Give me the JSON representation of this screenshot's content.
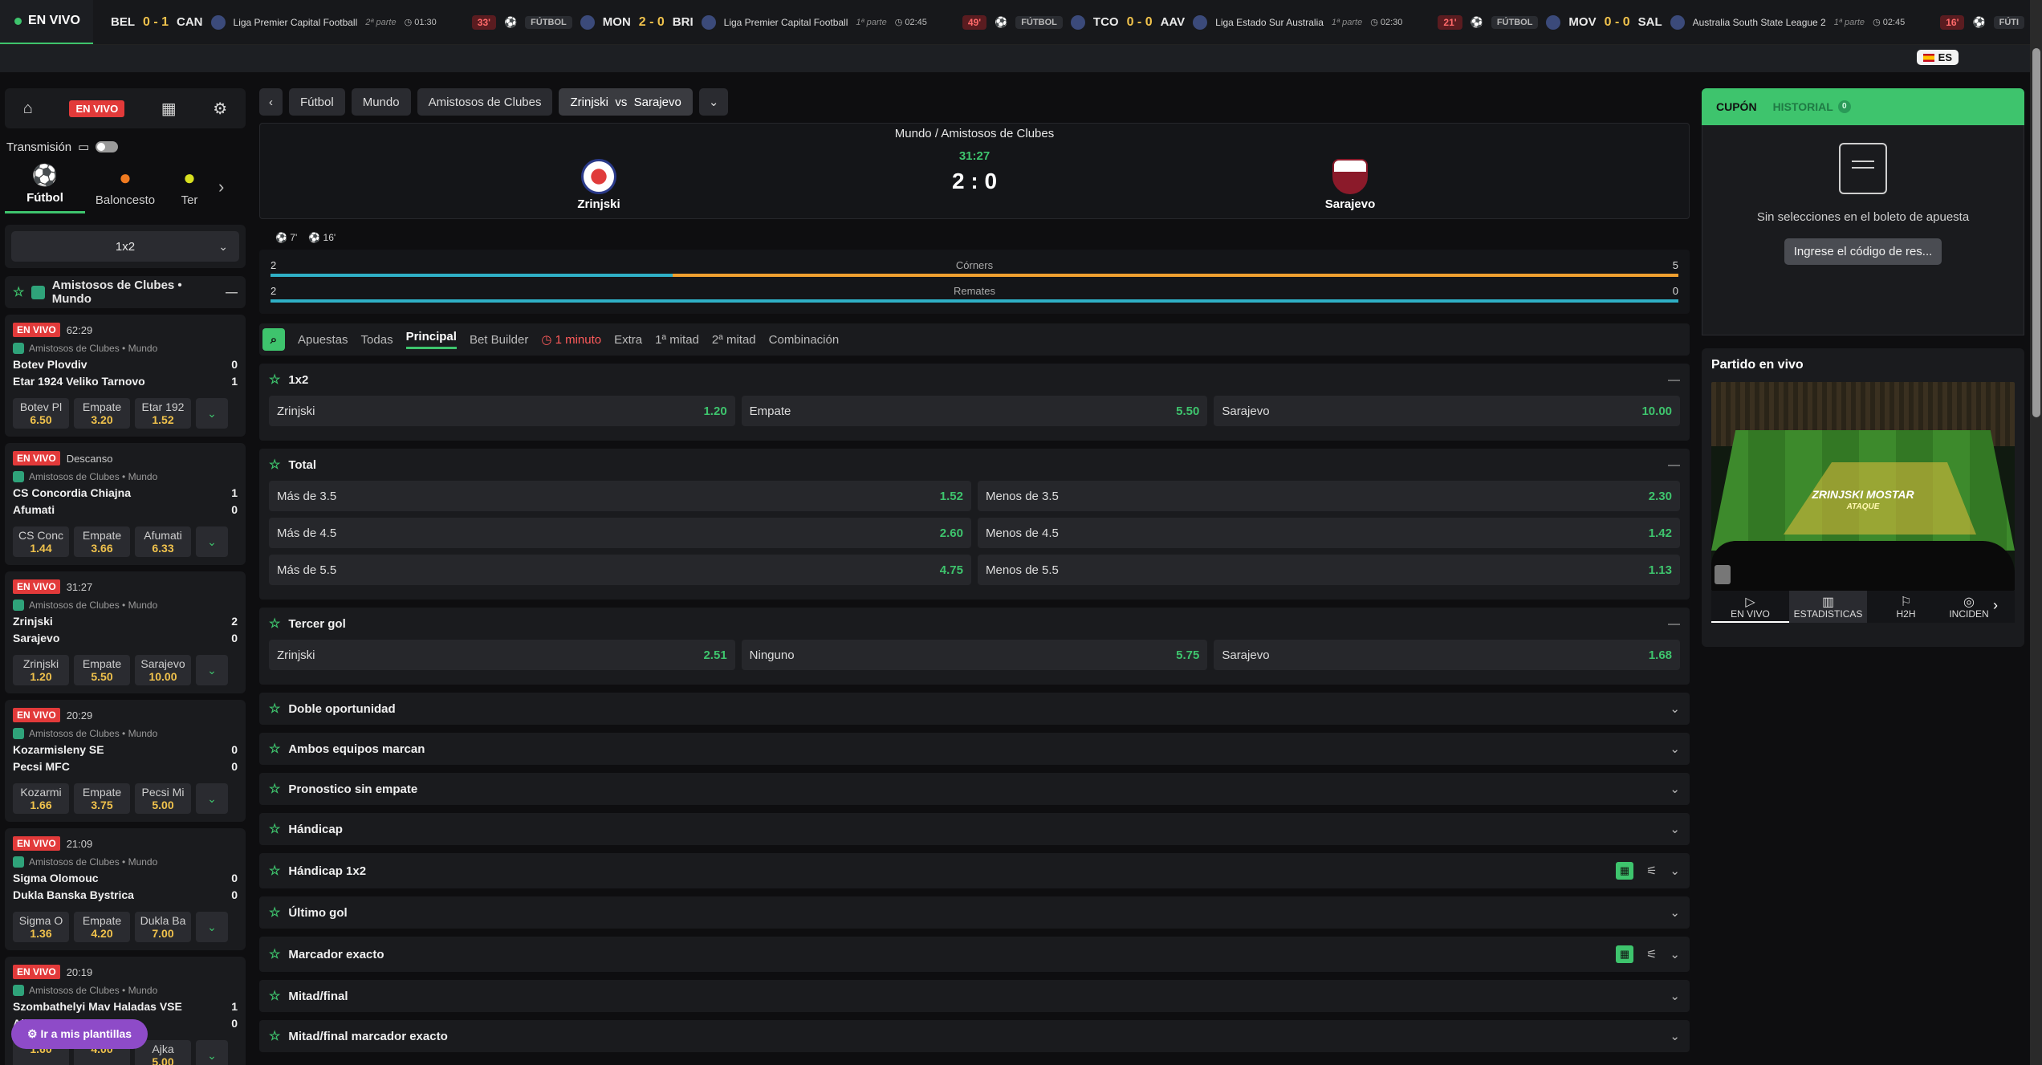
{
  "ticker": {
    "live_label": "EN VIVO",
    "items": [
      {
        "home": "BEL",
        "score": "0 - 1",
        "away": "CAN",
        "league": "Liga Premier Capital Football",
        "half": "2ª parte",
        "clock": "01:30"
      },
      {
        "minute": "33'",
        "sport": "FÚTBOL",
        "home": "MON",
        "score": "2 - 0",
        "away": "BRI",
        "league": "Liga Premier Capital Football",
        "half": "1ª parte",
        "clock": "02:45"
      },
      {
        "minute": "49'",
        "sport": "FÚTBOL",
        "home": "TCO",
        "score": "0 - 0",
        "away": "AAV",
        "league": "Liga Estado Sur Australia",
        "half": "1ª parte",
        "clock": "02:30"
      },
      {
        "minute": "21'",
        "sport": "FÚTBOL",
        "home": "MOV",
        "score": "0 - 0",
        "away": "SAL",
        "league": "Australia South State League 2",
        "half": "1ª parte",
        "clock": "02:45"
      },
      {
        "minute": "16'",
        "sport": "FÚTI"
      }
    ]
  },
  "lang": "ES",
  "sidebar": {
    "live_label": "EN VIVO",
    "transmission_label": "Transmisión",
    "sports": [
      {
        "label": "Fútbol",
        "icon": "soccer-ball-icon"
      },
      {
        "label": "Baloncesto",
        "icon": "basketball-icon"
      },
      {
        "label": "Ter",
        "icon": "tennis-ball-icon"
      }
    ],
    "market_select": "1x2",
    "league_header": "Amistosos de Clubes • Mundo",
    "league_tag": "Amistosos de Clubes • Mundo",
    "cards": [
      {
        "live": "EN VIVO",
        "time": "62:29",
        "home": "Botev Plovdiv",
        "away": "Etar 1924 Veliko Tarnovo",
        "hs": "0",
        "as": "1",
        "odds": [
          {
            "n": "Botev Pl",
            "v": "6.50"
          },
          {
            "n": "Empate",
            "v": "3.20"
          },
          {
            "n": "Etar 192",
            "v": "1.52"
          }
        ]
      },
      {
        "live": "EN VIVO",
        "time": "Descanso",
        "home": "CS Concordia Chiajna",
        "away": "Afumati",
        "hs": "1",
        "as": "0",
        "odds": [
          {
            "n": "CS Conc",
            "v": "1.44"
          },
          {
            "n": "Empate",
            "v": "3.66"
          },
          {
            "n": "Afumati",
            "v": "6.33"
          }
        ]
      },
      {
        "live": "EN VIVO",
        "time": "31:27",
        "home": "Zrinjski",
        "away": "Sarajevo",
        "hs": "2",
        "as": "0",
        "odds": [
          {
            "n": "Zrinjski",
            "v": "1.20"
          },
          {
            "n": "Empate",
            "v": "5.50"
          },
          {
            "n": "Sarajevo",
            "v": "10.00"
          }
        ]
      },
      {
        "live": "EN VIVO",
        "time": "20:29",
        "home": "Kozarmisleny SE",
        "away": "Pecsi MFC",
        "hs": "0",
        "as": "0",
        "odds": [
          {
            "n": "Kozarmi",
            "v": "1.66"
          },
          {
            "n": "Empate",
            "v": "3.75"
          },
          {
            "n": "Pecsi Mi",
            "v": "5.00"
          }
        ]
      },
      {
        "live": "EN VIVO",
        "time": "21:09",
        "home": "Sigma Olomouc",
        "away": "Dukla Banska Bystrica",
        "hs": "0",
        "as": "0",
        "odds": [
          {
            "n": "Sigma O",
            "v": "1.36"
          },
          {
            "n": "Empate",
            "v": "4.20"
          },
          {
            "n": "Dukla Ba",
            "v": "7.00"
          }
        ]
      },
      {
        "live": "EN VIVO",
        "time": "20:19",
        "home": "Szombathelyi Mav Haladas VSE",
        "away": "Ajka",
        "hs": "1",
        "as": "0",
        "odds": [
          {
            "n": "",
            "v": "1.60"
          },
          {
            "n": "",
            "v": "4.00"
          },
          {
            "n": "Ajka",
            "v": "5.00"
          }
        ]
      }
    ],
    "templates_button": "Ir a mis plantillas"
  },
  "breadcrumbs": [
    "Fútbol",
    "Mundo",
    "Amistosos de Clubes",
    "Zrinjski  vs  Sarajevo"
  ],
  "match": {
    "competition": "Mundo / Amistosos de Clubes",
    "time": "31:27",
    "score": "2 : 0",
    "home": "Zrinjski",
    "away": "Sarajevo",
    "events": [
      "7'",
      "16'"
    ],
    "stats": [
      {
        "label": "Córners",
        "home": "2",
        "away": "5",
        "home_frac": 0.2857
      },
      {
        "label": "Remates",
        "home": "2",
        "away": "0",
        "home_frac": 1.0
      }
    ]
  },
  "tabs": [
    "Apuestas",
    "Todas",
    "Principal",
    "Bet Builder",
    "1 minuto",
    "Extra",
    "1ª mitad",
    "2ª mitad",
    "Combinación"
  ],
  "markets": {
    "m1x2": {
      "title": "1x2",
      "odds": [
        {
          "n": "Zrinjski",
          "v": "1.20"
        },
        {
          "n": "Empate",
          "v": "5.50"
        },
        {
          "n": "Sarajevo",
          "v": "10.00"
        }
      ]
    },
    "total": {
      "title": "Total",
      "rows": [
        [
          {
            "n": "Más de 3.5",
            "v": "1.52"
          },
          {
            "n": "Menos de 3.5",
            "v": "2.30"
          }
        ],
        [
          {
            "n": "Más de 4.5",
            "v": "2.60"
          },
          {
            "n": "Menos de 4.5",
            "v": "1.42"
          }
        ],
        [
          {
            "n": "Más de 5.5",
            "v": "4.75"
          },
          {
            "n": "Menos de 5.5",
            "v": "1.13"
          }
        ]
      ]
    },
    "tercer": {
      "title": "Tercer gol",
      "odds": [
        {
          "n": "Zrinjski",
          "v": "2.51"
        },
        {
          "n": "Ninguno",
          "v": "5.75"
        },
        {
          "n": "Sarajevo",
          "v": "1.68"
        }
      ]
    },
    "collapsed": [
      "Doble oportunidad",
      "Ambos equipos marcan",
      "Pronostico sin empate",
      "Hándicap",
      "Hándicap 1x2",
      "Último gol",
      "Marcador exacto",
      "Mitad/final",
      "Mitad/final marcador exacto"
    ]
  },
  "betslip": {
    "tab_coupon": "CUPÓN",
    "tab_history": "HISTORIAL",
    "history_count": "0",
    "empty_text": "Sin selecciones en el boleto de apuesta",
    "code_button": "Ingrese el código de res..."
  },
  "live_match": {
    "title": "Partido en vivo",
    "zone_team": "ZRINJSKI MOSTAR",
    "zone_action": "ATAQUE",
    "tabs": [
      "EN VIVO",
      "ESTADISTICAS",
      "H2H",
      "INCIDEN"
    ]
  }
}
